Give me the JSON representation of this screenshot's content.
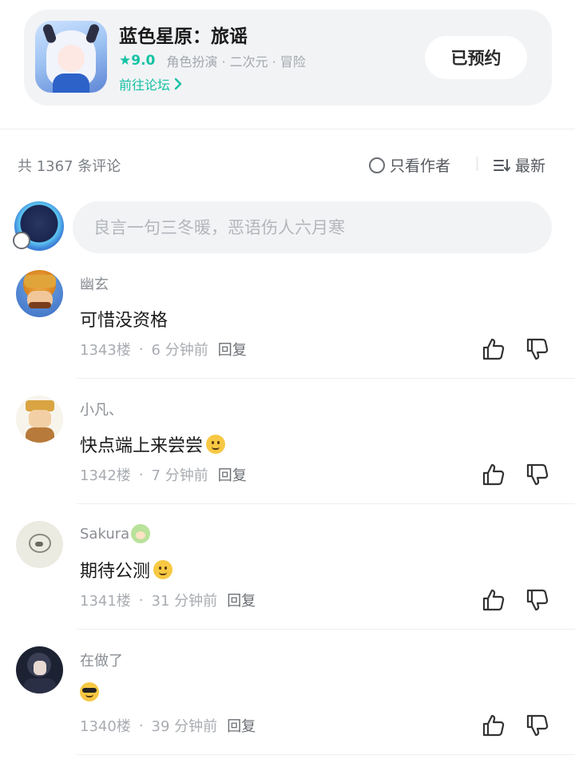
{
  "game": {
    "title": "蓝色星原：旅谣",
    "rating": "★9.0",
    "tags": "角色扮演 · 二次元 · 冒险",
    "forum_link": "前往论坛",
    "reserved_label": "已预约"
  },
  "comments_header": {
    "count_text": "共 1367 条评论",
    "author_only": "只看作者",
    "sort_label": "最新"
  },
  "input": {
    "placeholder": "良言一句三冬暖，恶语伤人六月寒"
  },
  "comments": [
    {
      "name": "幽玄",
      "text": "可惜没资格",
      "floor": "1343楼",
      "time": "6 分钟前",
      "reply": "回复"
    },
    {
      "name": "小凡、",
      "text": "快点端上来尝尝",
      "floor": "1342楼",
      "time": "7 分钟前",
      "reply": "回复"
    },
    {
      "name": "Sakura",
      "text": "期待公测",
      "floor": "1341楼",
      "time": "31 分钟前",
      "reply": "回复"
    },
    {
      "name": "在做了",
      "text": "",
      "floor": "1340楼",
      "time": "39 分钟前",
      "reply": "回复"
    }
  ],
  "colors": {
    "accent": "#14c2a3",
    "card_bg": "#f2f3f5",
    "muted_text": "#a8acb1"
  }
}
